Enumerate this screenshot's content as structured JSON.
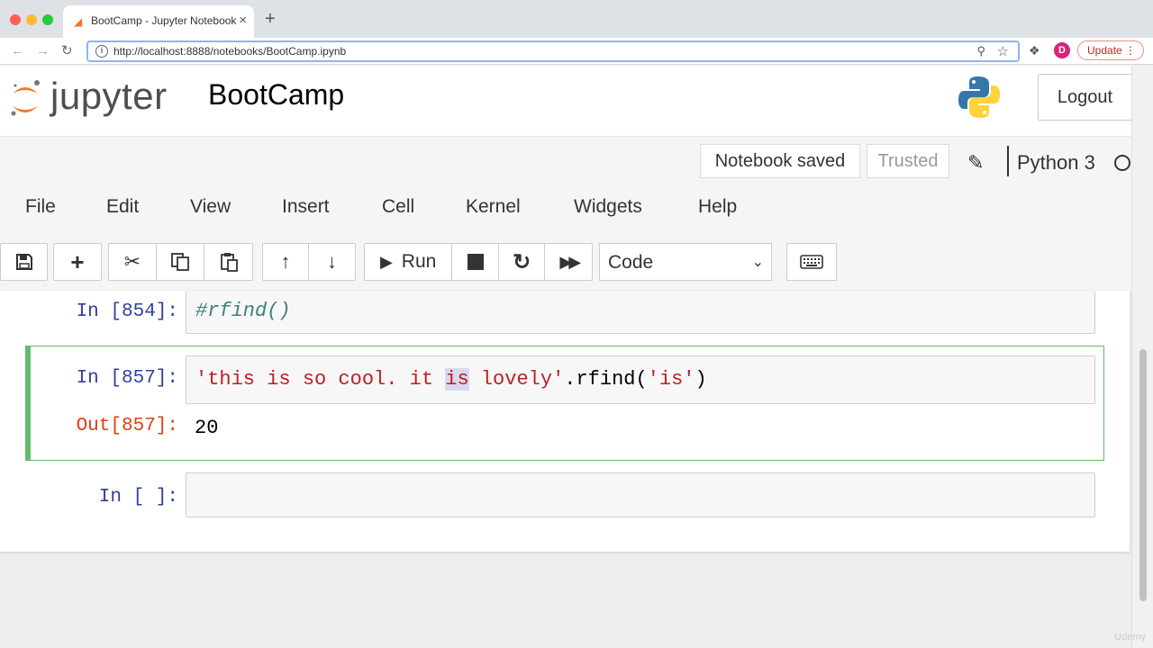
{
  "browser": {
    "tab_title": "BootCamp - Jupyter Notebook",
    "url": "http://localhost:8888/notebooks/BootCamp.ipynb",
    "update_label": "Update",
    "profile_initial": "D"
  },
  "header": {
    "logo_text": "jupyter",
    "notebook_title": "BootCamp",
    "logout_label": "Logout"
  },
  "status": {
    "save_state": "Notebook saved",
    "trusted": "Trusted",
    "kernel": "Python 3"
  },
  "menu": [
    "File",
    "Edit",
    "View",
    "Insert",
    "Cell",
    "Kernel",
    "Widgets",
    "Help"
  ],
  "toolbar": {
    "run_label": "Run",
    "cell_type": "Code"
  },
  "cells": [
    {
      "prompt": "In [854]:",
      "code": "#rfind()"
    },
    {
      "prompt": "In [857]:",
      "code_parts": [
        "'this is so cool. it ",
        "is",
        " lovely'",
        ".rfind(",
        "'is'",
        ")"
      ],
      "out_prompt": "Out[857]:",
      "output": "20"
    },
    {
      "prompt": "In [ ]:",
      "code": ""
    }
  ],
  "watermark": "Udemy"
}
